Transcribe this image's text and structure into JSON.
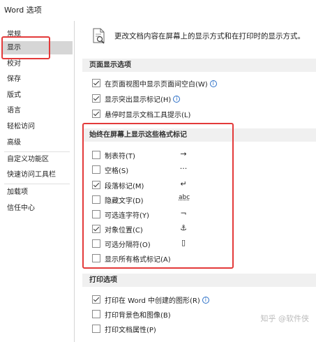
{
  "window": {
    "title": "Word 选项"
  },
  "sidebar": {
    "items": [
      "常规",
      "显示",
      "校对",
      "保存",
      "版式",
      "语言",
      "轻松访问",
      "高级",
      "自定义功能区",
      "快速访问工具栏",
      "加载项",
      "信任中心"
    ],
    "selected_index": 1
  },
  "content": {
    "header": "更改文档内容在屏幕上的显示方式和在打印时的显示方式。",
    "page_display": {
      "title": "页面显示选项",
      "options": [
        {
          "label": "在页面视图中显示页面间空白(W)",
          "checked": true,
          "info": true
        },
        {
          "label": "显示突出显示标记(H)",
          "checked": true,
          "info": true
        },
        {
          "label": "悬停时显示文档工具提示(L)",
          "checked": true,
          "info": false
        }
      ]
    },
    "format_marks": {
      "title": "始终在屏幕上显示这些格式标记",
      "options": [
        {
          "label": "制表符(T)",
          "checked": false,
          "symbol": "→"
        },
        {
          "label": "空格(S)",
          "checked": false,
          "symbol": "···"
        },
        {
          "label": "段落标记(M)",
          "checked": true,
          "symbol": "↵"
        },
        {
          "label": "隐藏文字(D)",
          "checked": false,
          "symbol": "abc"
        },
        {
          "label": "可选连字符(Y)",
          "checked": false,
          "symbol": "¬"
        },
        {
          "label": "对象位置(C)",
          "checked": true,
          "symbol": "⚓"
        },
        {
          "label": "可选分隔符(O)",
          "checked": false,
          "symbol": "▯"
        },
        {
          "label": "显示所有格式标记(A)",
          "checked": false,
          "symbol": ""
        }
      ]
    },
    "print": {
      "title": "打印选项",
      "options": [
        {
          "label": "打印在 Word 中创建的图形(R)",
          "checked": true,
          "info": true
        },
        {
          "label": "打印背景色和图像(B)",
          "checked": false,
          "info": false
        },
        {
          "label": "打印文档属性(P)",
          "checked": false,
          "info": false
        }
      ]
    }
  },
  "watermark": "知乎 @软件侠",
  "colors": {
    "highlight_border": "#e33a3a",
    "selected_bg": "#d6d6d6",
    "section_bg": "#f0f0f0",
    "info_blue": "#2b6fc7"
  }
}
